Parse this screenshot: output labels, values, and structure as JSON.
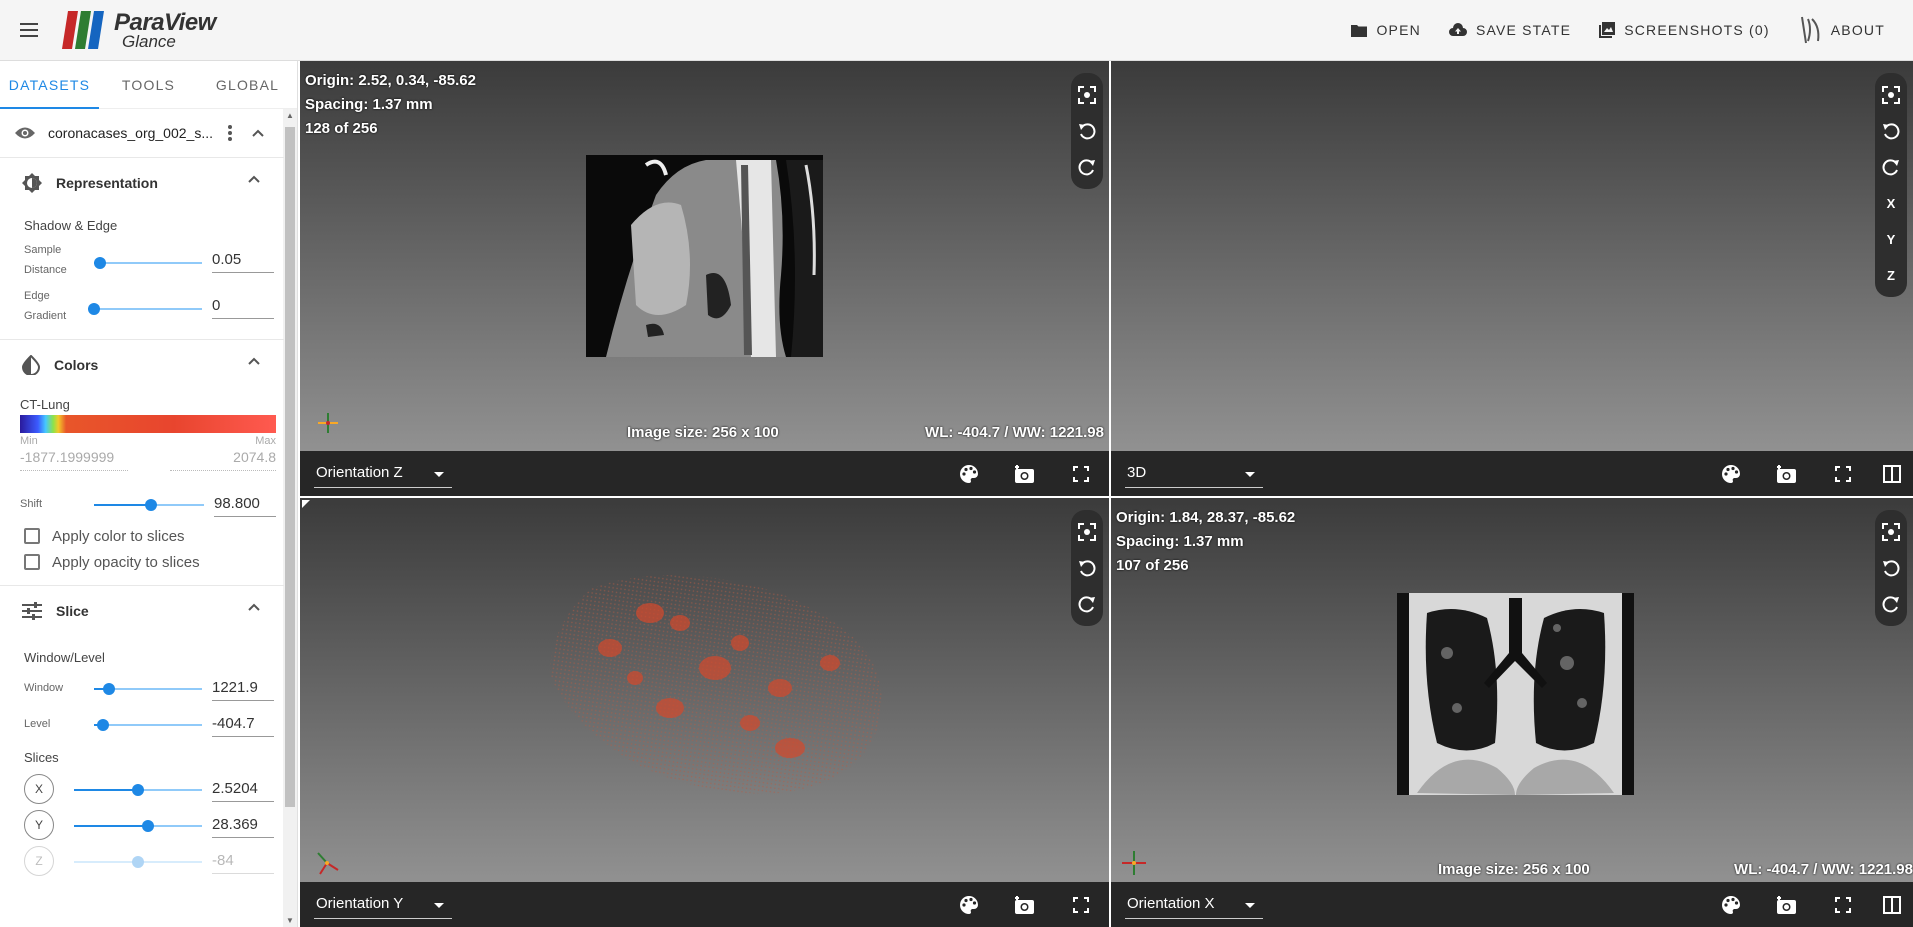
{
  "app": {
    "logo_line1": "ParaView",
    "logo_line2": "Glance"
  },
  "toolbar": {
    "open_label": "OPEN",
    "save_state_label": "SAVE STATE",
    "screenshots_label": "SCREENSHOTS (0)",
    "about_label": "ABOUT"
  },
  "tabs": [
    {
      "label": "DATASETS",
      "active": true
    },
    {
      "label": "TOOLS",
      "active": false
    },
    {
      "label": "GLOBAL",
      "active": false
    }
  ],
  "dataset": {
    "name": "coronacases_org_002_s..."
  },
  "representation": {
    "title": "Representation",
    "shadow_edge_label": "Shadow & Edge",
    "sample_distance_label_1": "Sample",
    "sample_distance_label_2": "Distance",
    "sample_distance_value": "0.05",
    "sample_distance_level": 0.06,
    "edge_gradient_label_1": "Edge",
    "edge_gradient_label_2": "Gradient",
    "edge_gradient_value": "0",
    "edge_gradient_level": 0.0
  },
  "colors": {
    "title": "Colors",
    "preset_name": "CT-Lung",
    "min_label": "Min",
    "max_label": "Max",
    "min_value": "-1877.1999999",
    "max_value": "2074.8",
    "shift_label": "Shift",
    "shift_value": "98.800",
    "shift_level": 0.52,
    "apply_color_label": "Apply color to slices",
    "apply_opacity_label": "Apply opacity to slices"
  },
  "slice": {
    "title": "Slice",
    "window_level_label": "Window/Level",
    "window_label": "Window",
    "window_value": "1221.9",
    "window_level": 0.14,
    "level_label": "Level",
    "level_value": "-404.7",
    "level_level": 0.08,
    "slices_label": "Slices",
    "x_label": "X",
    "x_value": "2.5204",
    "x_level": 0.5,
    "y_label": "Y",
    "y_value": "28.369",
    "y_level": 0.58,
    "z_label": "Z",
    "z_value": "-84"
  },
  "views": {
    "top_left": {
      "origin": "Origin: 2.52, 0.34, -85.62",
      "spacing": "Spacing: 1.37 mm",
      "slice_index": "128 of 256",
      "image_size": "Image size: 256 x 100",
      "wl_ww": "WL: -404.7 / WW: 1221.98",
      "orientation": "Orientation Z"
    },
    "top_right": {
      "orientation": "3D",
      "axis_x": "X",
      "axis_y": "Y",
      "axis_z": "Z"
    },
    "bottom_left": {
      "orientation": "Orientation Y"
    },
    "bottom_right": {
      "origin": "Origin: 1.84, 28.37, -85.62",
      "spacing": "Spacing: 1.37 mm",
      "slice_index": "107 of 256",
      "image_size": "Image size: 256 x 100",
      "wl_ww": "WL: -404.7 / WW: 1221.98",
      "orientation": "Orientation X"
    }
  },
  "icons": {
    "menu": "menu-icon",
    "open": "folder-icon",
    "save": "cloud-upload-icon",
    "screenshots": "images-icon",
    "about": "kitware-icon",
    "visibility": "eye-icon",
    "more": "dots-vertical-icon",
    "collapse": "chevron-up-icon",
    "reset_camera": "focus-icon",
    "rotate_left": "rotate-left-icon",
    "rotate_right": "rotate-right-icon",
    "palette": "palette-icon",
    "screenshot": "camera-plus-icon",
    "fullscreen": "fullscreen-icon",
    "split": "split-view-icon"
  },
  "colors_theme": {
    "accent": "#1e88e5",
    "view_bar": "#262626"
  }
}
